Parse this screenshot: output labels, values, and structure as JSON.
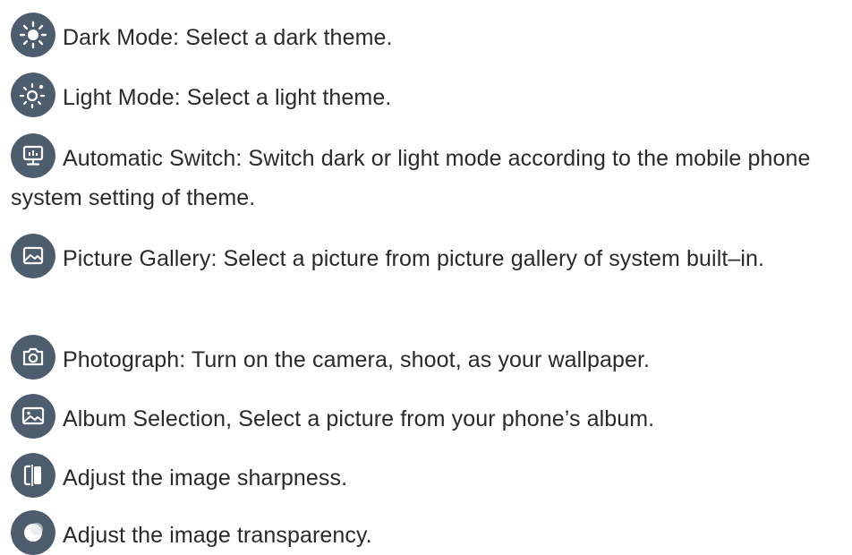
{
  "colors": {
    "icon_bg": "#4e5d6e",
    "icon_fg": "#ffffff",
    "text": "#2a2a2a"
  },
  "items": [
    {
      "icon": "dark-mode-icon",
      "text": "Dark Mode: Select a dark theme."
    },
    {
      "icon": "light-mode-icon",
      "text": "Light Mode: Select a light theme."
    },
    {
      "icon": "automatic-switch-icon",
      "text": "Automatic Switch: Switch dark or light mode according to the mobile phone system setting of theme."
    },
    {
      "icon": "picture-gallery-icon",
      "text": "Picture Gallery: Select a picture from picture gallery of system built–in."
    },
    {
      "icon": "camera-icon",
      "text": "Photograph: Turn on the camera, shoot, as your wallpaper."
    },
    {
      "icon": "album-icon",
      "text": "Album Selection, Select a picture from your phone’s album."
    },
    {
      "icon": "sharpness-icon",
      "text": "Adjust the image sharpness."
    },
    {
      "icon": "transparency-icon",
      "text": "Adjust the image transparency."
    }
  ]
}
